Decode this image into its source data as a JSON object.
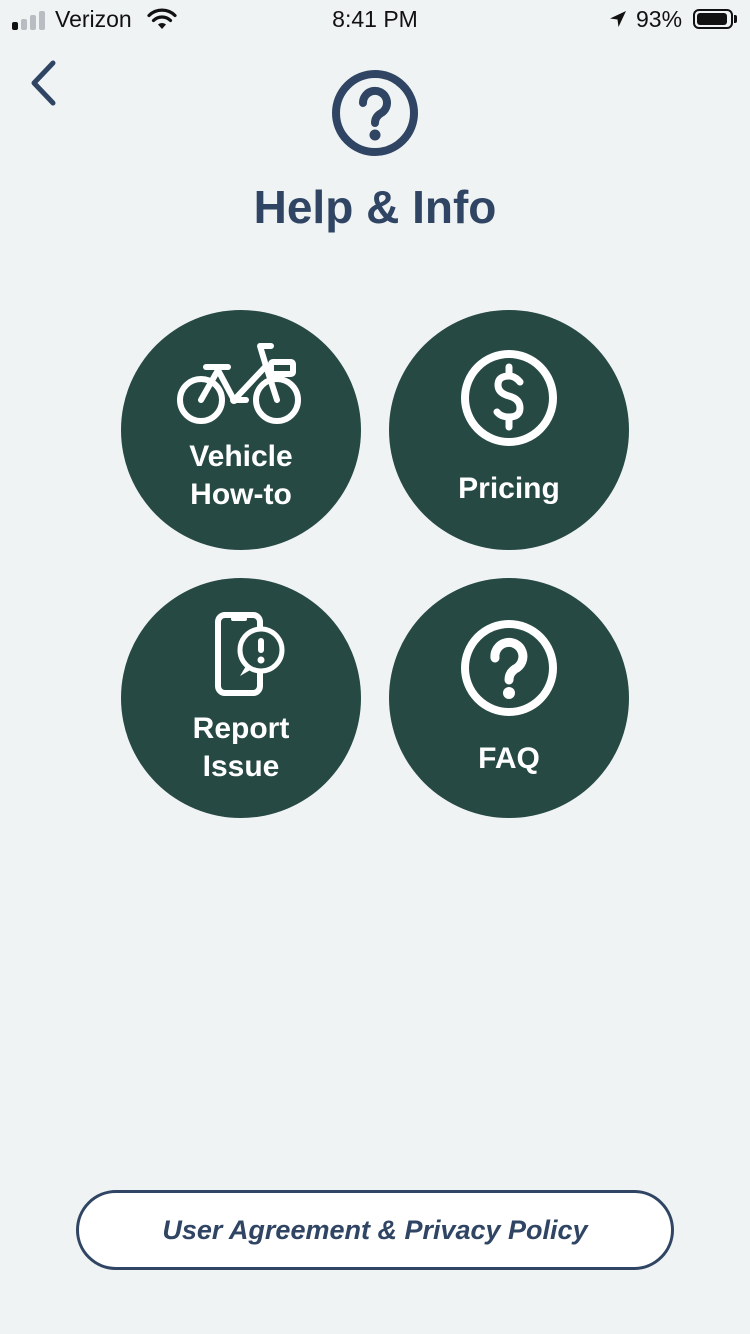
{
  "status_bar": {
    "carrier": "Verizon",
    "time": "8:41 PM",
    "battery_percent": "93%",
    "battery_level": 0.93,
    "signal_bars_active": 1,
    "signal_bars_total": 4
  },
  "header": {
    "back_icon": "chevron-left-icon",
    "icon": "question-circle-icon",
    "title": "Help & Info"
  },
  "tiles": [
    {
      "label": "Vehicle\nHow-to",
      "icon": "bike-icon"
    },
    {
      "label": "Pricing",
      "icon": "dollar-circle-icon"
    },
    {
      "label": "Report\nIssue",
      "icon": "phone-alert-icon"
    },
    {
      "label": "FAQ",
      "icon": "question-circle-icon"
    }
  ],
  "footer": {
    "legal_label": "User Agreement & Privacy Policy"
  },
  "colors": {
    "background": "#f0f3f4",
    "primary_text": "#2f4563",
    "tile_fill": "#264944",
    "tile_text": "#ffffff"
  }
}
